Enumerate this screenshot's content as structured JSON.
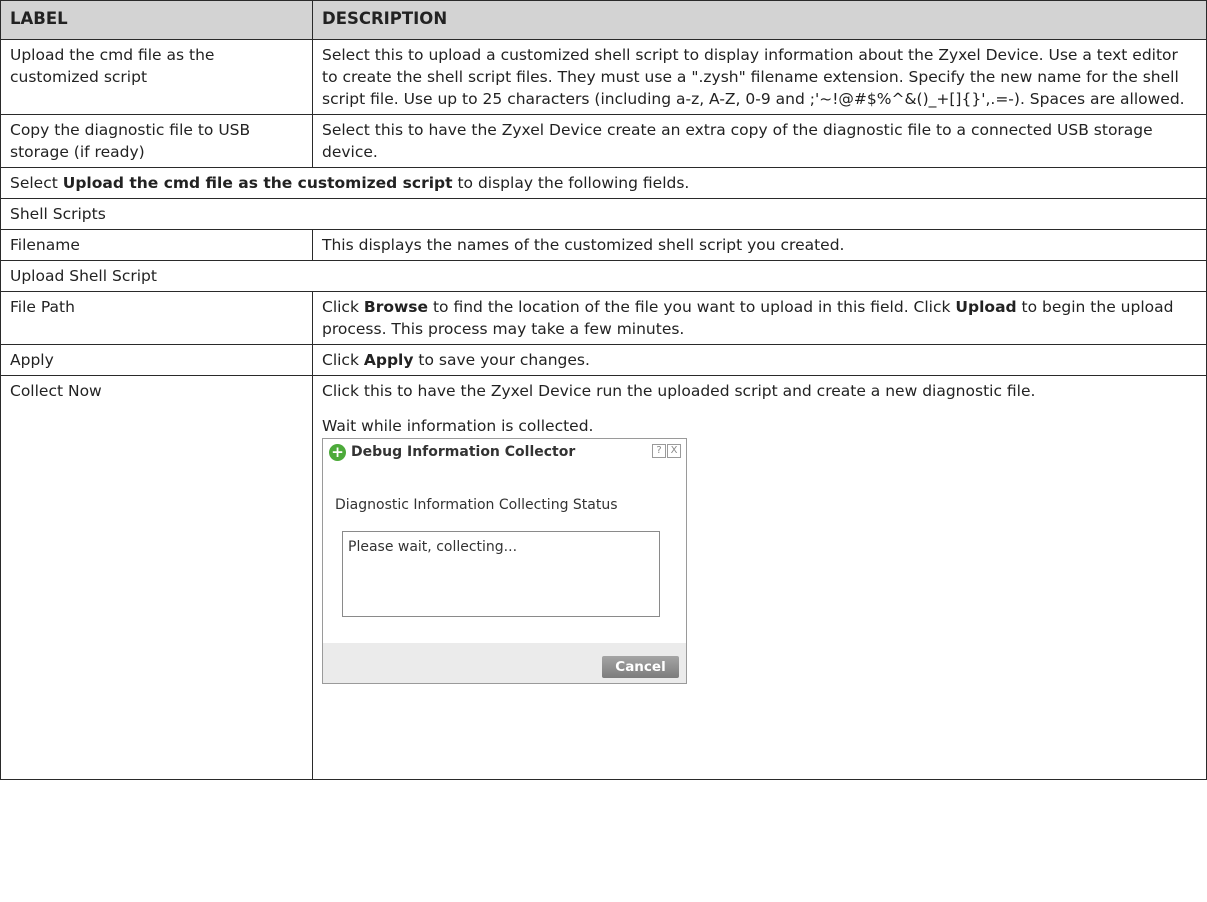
{
  "header": {
    "label": "LABEL",
    "description": "DESCRIPTION"
  },
  "rows": [
    {
      "label": "Upload the cmd file as the customized script",
      "desc": "Select this to upload a customized shell script to display information about the Zyxel Device. Use a text editor to create the shell script files. They must use a \".zysh\" filename extension. Specify the new name for the shell script file. Use up to 25 characters (including a-z, A-Z, 0-9 and ;'~!@#$%^&()_+[]{}',.=-). Spaces are allowed."
    },
    {
      "label": "Copy the diagnostic file to USB storage (if ready)",
      "desc": "Select this to have the Zyxel Device create an extra copy of the diagnostic file to a connected USB storage device."
    }
  ],
  "note": {
    "prefix": "Select ",
    "bold": "Upload the cmd file as the customized script",
    "suffix": " to display the following fields."
  },
  "section1": "Shell Scripts",
  "filename": {
    "label": "Filename",
    "desc": "This displays the names of the customized shell script you created."
  },
  "section2": "Upload Shell Script",
  "filepath": {
    "label": "File Path",
    "pre": "Click ",
    "b1": "Browse",
    "mid": " to find the location of the file you want to upload in this field. Click ",
    "b2": "Upload",
    "post": " to begin the upload process. This process may take a few minutes."
  },
  "apply": {
    "label": "Apply",
    "pre": "Click ",
    "b": "Apply",
    "post": " to save your changes."
  },
  "collect": {
    "label": "Collect Now",
    "desc": "Click this to have the Zyxel Device run the uploaded script and create a new diagnostic file.",
    "wait": "Wait while information is collected."
  },
  "dialog": {
    "title": "Debug Information Collector",
    "help": "?",
    "close": "X",
    "status_label": "Diagnostic Information Collecting Status",
    "status_text": "Please wait, collecting...",
    "cancel": "Cancel"
  }
}
